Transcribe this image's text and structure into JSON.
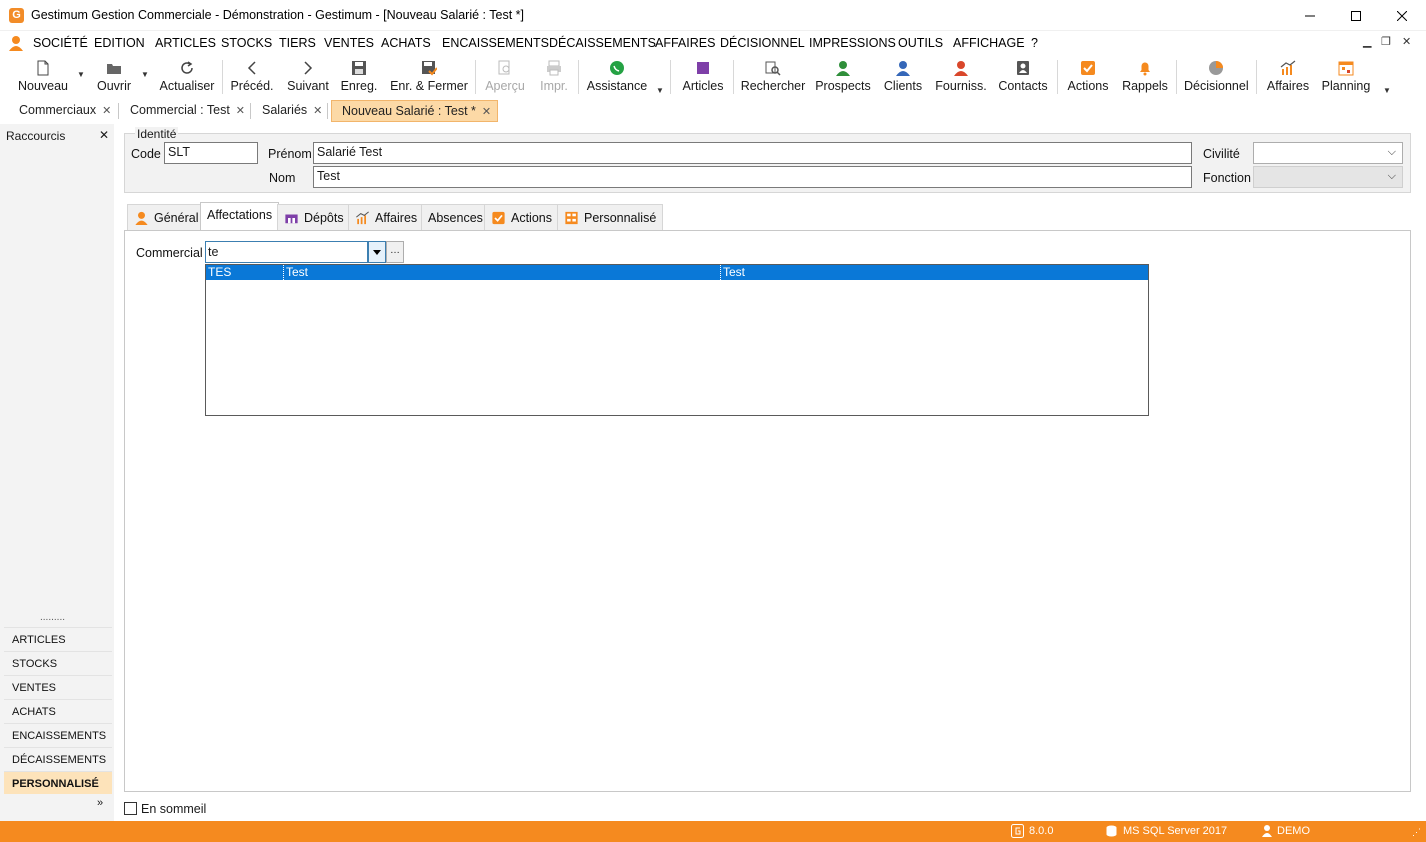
{
  "window": {
    "title": "Gestimum Gestion Commerciale - Démonstration - Gestimum - [Nouveau Salarié : Test *]",
    "logo_letter": "G"
  },
  "menu": [
    "SOCIÉTÉ",
    "EDITION",
    "ARTICLES",
    "STOCKS",
    "TIERS",
    "VENTES",
    "ACHATS",
    "ENCAISSEMENTS",
    "DÉCAISSEMENTS",
    "AFFAIRES",
    "DÉCISIONNEL",
    "IMPRESSIONS",
    "OUTILS",
    "AFFICHAGE",
    "?"
  ],
  "toolbar": {
    "nouveau": "Nouveau",
    "ouvrir": "Ouvrir",
    "actualiser": "Actualiser",
    "preced": "Précéd.",
    "suivant": "Suivant",
    "enreg": "Enreg.",
    "enr_fermer": "Enr. & Fermer",
    "apercu": "Aperçu",
    "impr": "Impr.",
    "assistance": "Assistance",
    "articles": "Articles",
    "rechercher": "Rechercher",
    "prospects": "Prospects",
    "clients": "Clients",
    "fourniss": "Fourniss.",
    "contacts": "Contacts",
    "actions": "Actions",
    "rappels": "Rappels",
    "decisionnel": "Décisionnel",
    "affaires": "Affaires",
    "planning": "Planning"
  },
  "doc_tabs": [
    "Commerciaux",
    "Commercial : Test",
    "Salariés",
    "Nouveau Salarié : Test *"
  ],
  "sidebar": {
    "title": "Raccourcis",
    "items": [
      "ARTICLES",
      "STOCKS",
      "VENTES",
      "ACHATS",
      "ENCAISSEMENTS",
      "DÉCAISSEMENTS",
      "PERSONNALISÉ"
    ]
  },
  "identity": {
    "group_label": "Identité",
    "code_label": "Code",
    "code_value": "SLT",
    "prenom_label": "Prénom",
    "prenom_value": "Salarié Test",
    "nom_label": "Nom",
    "nom_value": "Test",
    "civilite_label": "Civilité",
    "fonction_label": "Fonction"
  },
  "form_tabs": [
    "Général",
    "Affectations",
    "Dépôts",
    "Affaires",
    "Absences",
    "Actions",
    "Personnalisé"
  ],
  "affectations": {
    "commercial_label": "Commercial",
    "commercial_value": "te",
    "dropdown_rows": [
      {
        "code": "TES",
        "name": "Test",
        "name2": "Test"
      }
    ]
  },
  "sommeil_label": "En sommeil",
  "status": {
    "version": "8.0.0",
    "server": "MS SQL Server 2017",
    "user": "DEMO"
  },
  "colors": {
    "accent": "#f58a1f",
    "selection": "#0a78d7",
    "active_tab": "#fcd9a6"
  }
}
